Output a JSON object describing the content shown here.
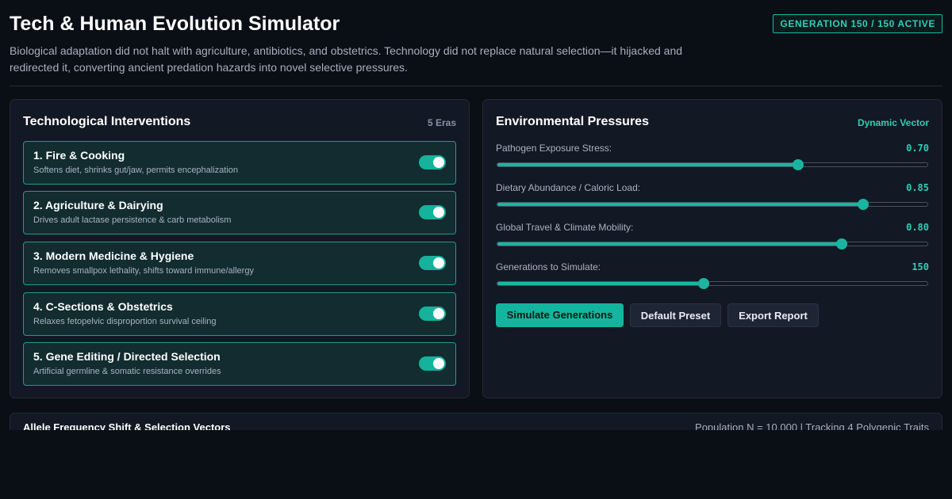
{
  "header": {
    "title": "Tech & Human Evolution Simulator",
    "badge": "GENERATION 150 / 150 ACTIVE",
    "subtitle": "Biological adaptation did not halt with agriculture, antibiotics, and obstetrics. Technology did not replace natural selection—it hijacked and redirected it, converting ancient predation hazards into novel selective pressures."
  },
  "interventions": {
    "title": "Technological Interventions",
    "tag": "5 Eras",
    "eras": [
      {
        "name": "1. Fire & Cooking",
        "desc": "Softens diet, shrinks gut/jaw, permits encephalization",
        "enabled": true
      },
      {
        "name": "2. Agriculture & Dairying",
        "desc": "Drives adult lactase persistence & carb metabolism",
        "enabled": true
      },
      {
        "name": "3. Modern Medicine & Hygiene",
        "desc": "Removes smallpox lethality, shifts toward immune/allergy",
        "enabled": true
      },
      {
        "name": "4. C-Sections & Obstetrics",
        "desc": "Relaxes fetopelvic disproportion survival ceiling",
        "enabled": true
      },
      {
        "name": "5. Gene Editing / Directed Selection",
        "desc": "Artificial germline & somatic resistance overrides",
        "enabled": true
      }
    ]
  },
  "pressures": {
    "title": "Environmental Pressures",
    "tag": "Dynamic Vector",
    "sliders": [
      {
        "label": "Pathogen Exposure Stress:",
        "value": "0.70",
        "fraction": 0.7
      },
      {
        "label": "Dietary Abundance / Caloric Load:",
        "value": "0.85",
        "fraction": 0.85
      },
      {
        "label": "Global Travel & Climate Mobility:",
        "value": "0.80",
        "fraction": 0.8
      },
      {
        "label": "Generations to Simulate:",
        "value": "150",
        "fraction": 0.48
      }
    ],
    "buttons": {
      "simulate": "Simulate Generations",
      "preset": "Default Preset",
      "export": "Export Report"
    }
  },
  "allele": {
    "title": "Allele Frequency Shift & Selection Vectors",
    "meta": "Population N = 10,000 | Tracking 4 Polygenic Traits"
  },
  "colors": {
    "accent": "#14b59e",
    "background": "#0a0e15",
    "panel": "#121824"
  }
}
